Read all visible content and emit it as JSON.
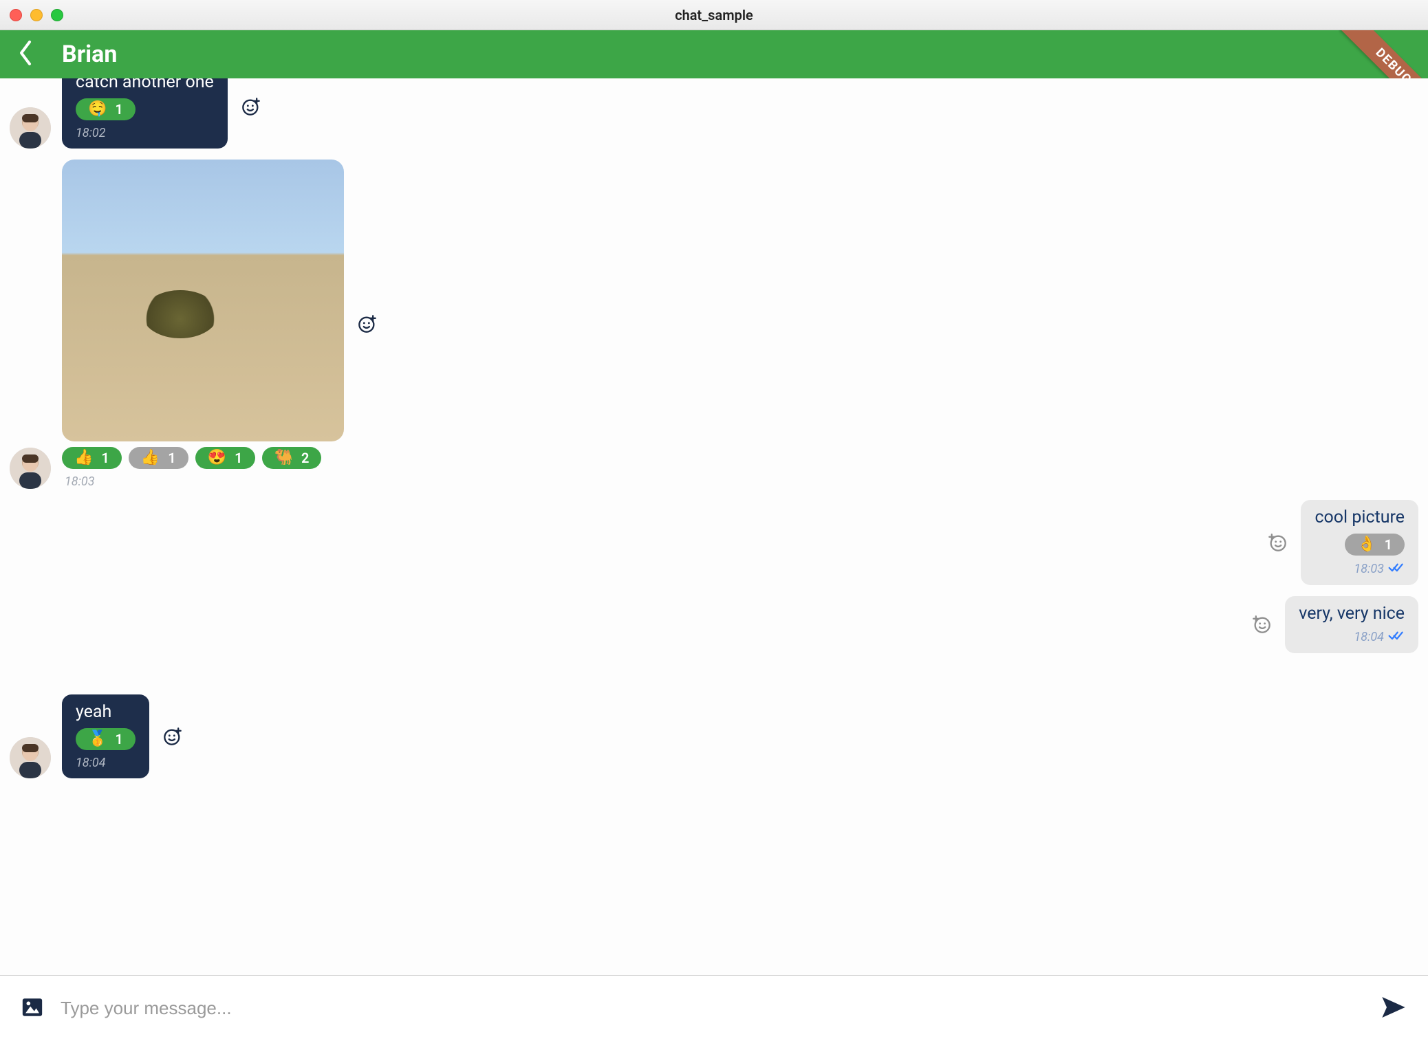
{
  "window": {
    "title": "chat_sample"
  },
  "banner": {
    "debug_label": "DEBUG"
  },
  "header": {
    "contact_name": "Brian"
  },
  "composer": {
    "placeholder": "Type your message..."
  },
  "messages": [
    {
      "id": "m1",
      "side": "left",
      "avatar": true,
      "text": "catch another one",
      "time": "18:02",
      "reactions": [
        {
          "emoji": "🤤",
          "count": 1,
          "tone": "green"
        }
      ]
    },
    {
      "id": "m2",
      "side": "left",
      "avatar": true,
      "image": true,
      "image_desc": "desert sand dunes with a small bush under a pale blue sky",
      "time": "18:03",
      "reactions": [
        {
          "emoji": "👍",
          "count": 1,
          "tone": "green"
        },
        {
          "emoji": "👍",
          "count": 1,
          "tone": "grey"
        },
        {
          "emoji": "😍",
          "count": 1,
          "tone": "green"
        },
        {
          "emoji": "🐫",
          "count": 2,
          "tone": "green"
        }
      ]
    },
    {
      "id": "m3",
      "side": "right",
      "text": "cool picture",
      "time": "18:03",
      "read": true,
      "reactions": [
        {
          "emoji": "👌",
          "count": 1,
          "tone": "grey"
        }
      ]
    },
    {
      "id": "m4",
      "side": "right",
      "text": "very, very nice",
      "time": "18:04",
      "read": true
    },
    {
      "id": "m5",
      "side": "left",
      "avatar": true,
      "text": "yeah",
      "time": "18:04",
      "reactions": [
        {
          "emoji": "🥇",
          "count": 1,
          "tone": "green"
        }
      ]
    }
  ]
}
